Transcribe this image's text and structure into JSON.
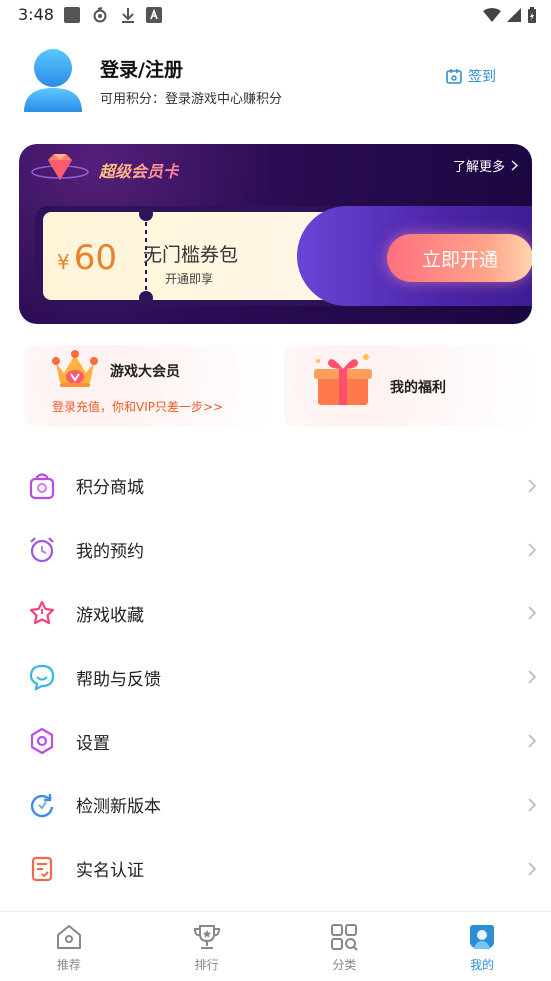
{
  "status_bar": {
    "time": "3:48"
  },
  "profile": {
    "name": "登录/注册",
    "points_line": "可用积分：登录游戏中心赚积分",
    "checkin_label": "签到"
  },
  "vip_card": {
    "title": "超级会员卡",
    "more_label": "了解更多",
    "coupon_currency": "¥",
    "coupon_amount": "60",
    "coupon_name": "无门槛券包",
    "coupon_desc": "开通即享",
    "open_button": "立即开通"
  },
  "features": {
    "left": {
      "title": "游戏大会员",
      "subtitle": "登录充值，你和VIP只差一步>>"
    },
    "right": {
      "title": "我的福利"
    }
  },
  "menu": [
    {
      "label": "积分商城",
      "icon": "shopping-bag-icon",
      "color": "#b84be0"
    },
    {
      "label": "我的预约",
      "icon": "alarm-clock-icon",
      "color": "#9b59e0"
    },
    {
      "label": "游戏收藏",
      "icon": "star-icon",
      "color": "#f0457a"
    },
    {
      "label": "帮助与反馈",
      "icon": "chat-bubble-icon",
      "color": "#35b6e8"
    },
    {
      "label": "设置",
      "icon": "gear-hexagon-icon",
      "color": "#c04ee6"
    },
    {
      "label": "检测新版本",
      "icon": "refresh-icon",
      "color": "#3a8fe6"
    },
    {
      "label": "实名认证",
      "icon": "id-card-icon",
      "color": "#f06a4a"
    }
  ],
  "bottom_nav": [
    {
      "label": "推荐",
      "icon": "home-icon",
      "active": false
    },
    {
      "label": "排行",
      "icon": "trophy-icon",
      "active": false
    },
    {
      "label": "分类",
      "icon": "category-grid-icon",
      "active": false
    },
    {
      "label": "我的",
      "icon": "profile-icon",
      "active": true
    }
  ],
  "colors": {
    "accent": "#2c8fd6",
    "vip_bg": "#2a0c52",
    "orange": "#f05b27"
  }
}
